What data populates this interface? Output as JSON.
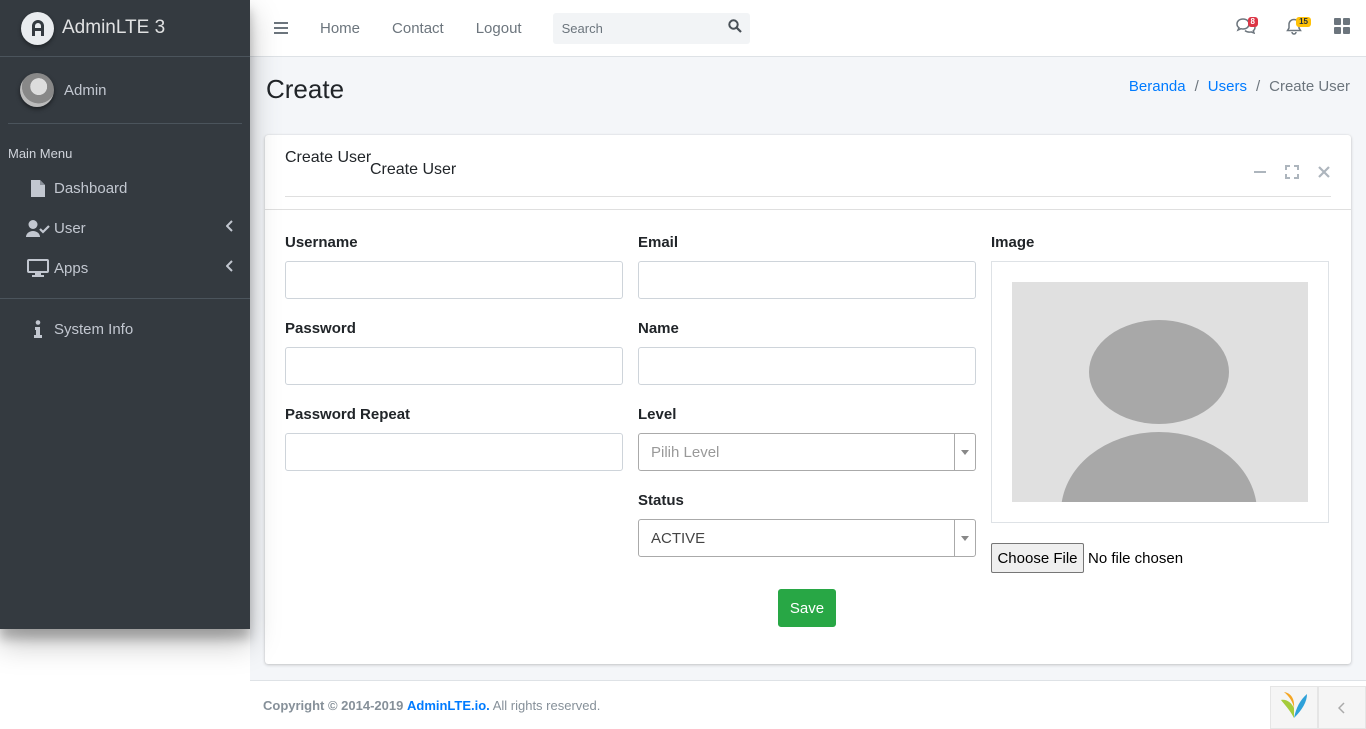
{
  "brand": {
    "name": "AdminLTE 3"
  },
  "user": {
    "name": "Admin"
  },
  "sidebar": {
    "header": "Main Menu",
    "items": [
      {
        "label": "Dashboard",
        "icon": "file-icon"
      },
      {
        "label": "User",
        "icon": "user-check-icon",
        "has_children": true
      },
      {
        "label": "Apps",
        "icon": "desktop-icon",
        "has_children": true
      },
      {
        "label": "System Info",
        "icon": "info-icon"
      }
    ]
  },
  "topbar": {
    "links": [
      "Home",
      "Contact",
      "Logout"
    ],
    "search_placeholder": "Search",
    "messages_count": "8",
    "notifications_count": "15"
  },
  "page": {
    "title": "Create",
    "breadcrumb": [
      "Beranda",
      "Users",
      "Create User"
    ]
  },
  "card": {
    "title": "Create User",
    "subtitle": "Create User"
  },
  "form": {
    "username_label": "Username",
    "password_label": "Password",
    "password_repeat_label": "Password Repeat",
    "email_label": "Email",
    "name_label": "Name",
    "level_label": "Level",
    "level_placeholder": "Pilih Level",
    "status_label": "Status",
    "status_value": "ACTIVE",
    "image_label": "Image",
    "file_button": "Choose File",
    "file_status": "No file chosen",
    "save_label": "Save"
  },
  "footer": {
    "prefix": "Copyright © 2014-2019",
    "link": "AdminLTE.io.",
    "suffix": "All rights reserved."
  },
  "colors": {
    "sidebar_bg": "#343a40",
    "primary": "#007bff",
    "success": "#28a745",
    "danger": "#dc3545",
    "warning": "#ffc107"
  }
}
